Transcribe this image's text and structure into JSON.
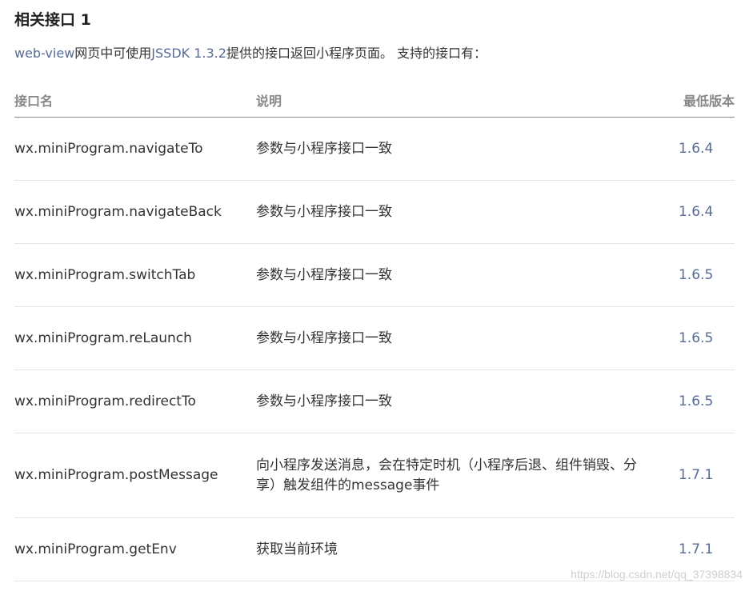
{
  "heading": "相关接口 1",
  "intro": {
    "link1": "web-view",
    "text1": "网页中可使用",
    "link2": "JSSDK 1.3.2",
    "text2": "提供的接口返回小程序页面。 支持的接口有："
  },
  "table": {
    "headers": [
      "接口名",
      "说明",
      "最低版本"
    ],
    "rows": [
      {
        "name": "wx.miniProgram.navigateTo",
        "desc": "参数与小程序接口一致",
        "version": "1.6.4"
      },
      {
        "name": "wx.miniProgram.navigateBack",
        "desc": "参数与小程序接口一致",
        "version": "1.6.4"
      },
      {
        "name": "wx.miniProgram.switchTab",
        "desc": "参数与小程序接口一致",
        "version": "1.6.5"
      },
      {
        "name": "wx.miniProgram.reLaunch",
        "desc": "参数与小程序接口一致",
        "version": "1.6.5"
      },
      {
        "name": "wx.miniProgram.redirectTo",
        "desc": "参数与小程序接口一致",
        "version": "1.6.5"
      },
      {
        "name": "wx.miniProgram.postMessage",
        "desc": "向小程序发送消息，会在特定时机（小程序后退、组件销毁、分享）触发组件的message事件",
        "version": "1.7.1"
      },
      {
        "name": "wx.miniProgram.getEnv",
        "desc": "获取当前环境",
        "version": "1.7.1"
      }
    ]
  },
  "watermark": "https://blog.csdn.net/qq_37398834",
  "colors": {
    "link": "#576b95",
    "header_text": "#888888",
    "body_text": "#333333"
  }
}
